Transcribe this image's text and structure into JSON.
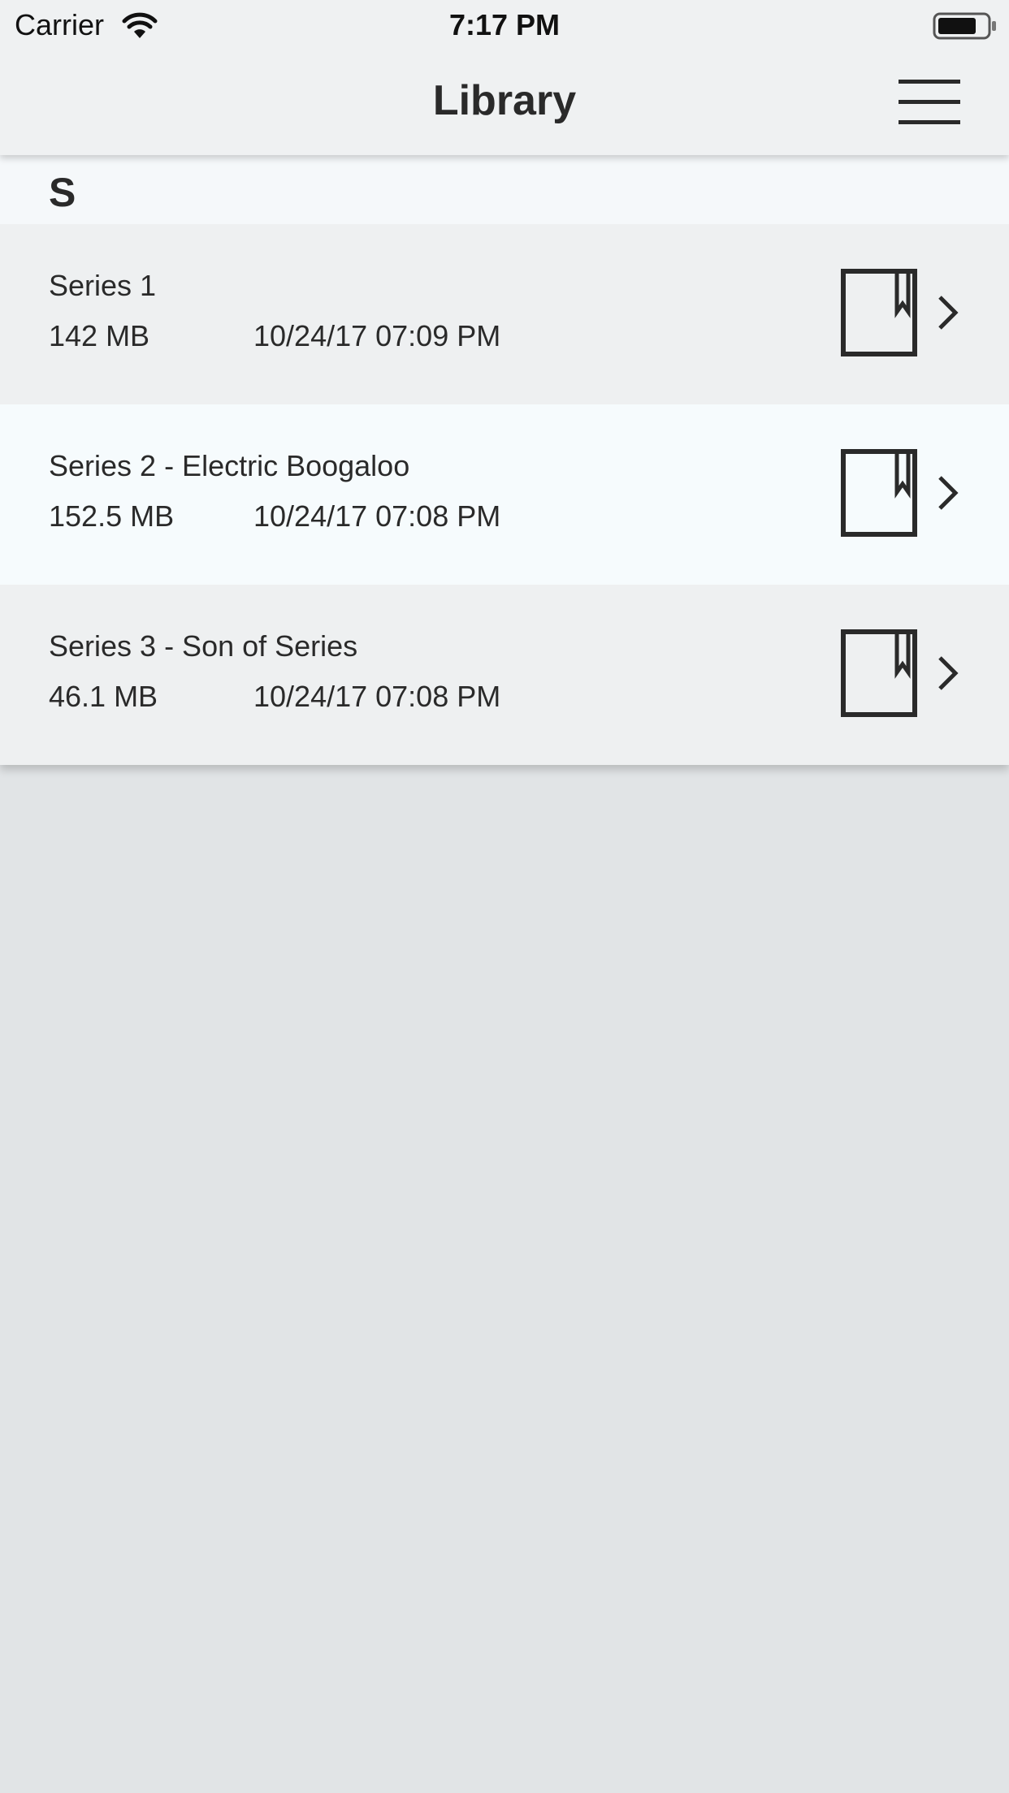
{
  "status_bar": {
    "carrier": "Carrier",
    "time": "7:17 PM",
    "wifi_icon": "wifi-icon",
    "battery_icon": "battery-icon"
  },
  "nav_bar": {
    "title": "Library",
    "menu_icon": "hamburger-menu-icon"
  },
  "library": {
    "section_letter": "S",
    "items": [
      {
        "title": "Series 1",
        "size": "142 MB",
        "date": "10/24/17 07:09 PM",
        "icon": "book-icon"
      },
      {
        "title": "Series 2 - Electric Boogaloo",
        "size": "152.5 MB",
        "date": "10/24/17 07:08 PM",
        "icon": "book-icon"
      },
      {
        "title": "Series 3 - Son of Series",
        "size": "46.1 MB",
        "date": "10/24/17 07:08 PM",
        "icon": "book-icon"
      }
    ]
  },
  "colors": {
    "nav_background": "#eff1f2",
    "row_odd": "#eef0f1",
    "row_even": "#f6fbfd",
    "section_header": "#f5f8fa",
    "empty_area": "#e1e4e6",
    "text": "#2a2a2a"
  }
}
